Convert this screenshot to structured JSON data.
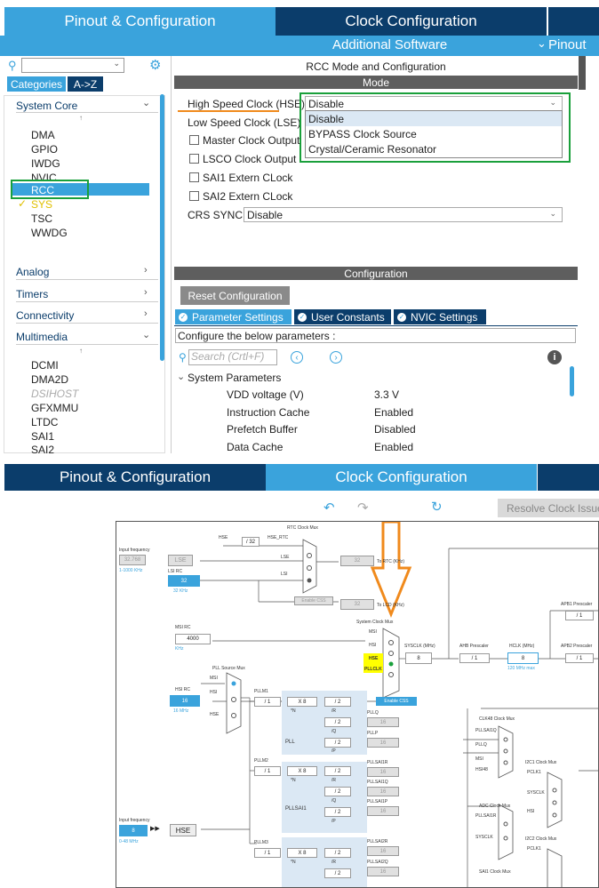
{
  "top": {
    "tabs": [
      {
        "label": "Pinout & Configuration"
      },
      {
        "label": "Clock Configuration"
      }
    ],
    "subbar": {
      "additional_software": "Additional Software",
      "pinout": "Pinout"
    },
    "sidebar": {
      "cat_tabs": [
        "Categories",
        "A->Z"
      ],
      "system_core": {
        "title": "System Core",
        "items": [
          "DMA",
          "GPIO",
          "IWDG",
          "NVIC",
          "RCC",
          "SYS",
          "TSC",
          "WWDG"
        ]
      },
      "groups": [
        "Analog",
        "Timers",
        "Connectivity",
        "Multimedia"
      ],
      "multimedia_items": [
        "DCMI",
        "DMA2D",
        "DSIHOST",
        "GFXMMU",
        "LTDC",
        "SAI1",
        "SAI2"
      ]
    },
    "rcc": {
      "title": "RCC Mode and Configuration",
      "mode_header": "Mode",
      "hse_label": "High Speed Clock (HSE)",
      "hse_value": "Disable",
      "lse_label": "Low Speed Clock (LSE)",
      "hse_options": [
        "Disable",
        "BYPASS Clock Source",
        "Crystal/Ceramic Resonator"
      ],
      "checkboxes": [
        "Master Clock Output",
        "LSCO Clock Output",
        "SAI1 Extern CLock",
        "SAI2 Extern CLock"
      ],
      "crs_label": "CRS SYNC",
      "crs_value": "Disable",
      "config_header": "Configuration",
      "reset_button": "Reset Configuration",
      "config_tabs": [
        "Parameter Settings",
        "User Constants",
        "NVIC Settings"
      ],
      "configure_text": "Configure the below parameters :",
      "search_placeholder": "Search (Crtl+F)",
      "section": "System Parameters",
      "params": [
        {
          "name": "VDD voltage (V)",
          "value": "3.3 V"
        },
        {
          "name": "Instruction Cache",
          "value": "Enabled"
        },
        {
          "name": "Prefetch Buffer",
          "value": "Disabled"
        },
        {
          "name": "Data Cache",
          "value": "Enabled"
        }
      ]
    }
  },
  "bottom": {
    "tabs": [
      {
        "label": "Pinout & Configuration"
      },
      {
        "label": "Clock Configuration"
      }
    ],
    "resolve_button": "Resolve Clock Issue",
    "diagram": {
      "input_frequency": "Input frequency",
      "lse_freq": "32.768",
      "lse_range": "1-1000 KHz",
      "lse": "LSE",
      "lsi_rc": "LSI RC",
      "lsi_val": "32",
      "lsi_unit": "32 KHz",
      "rtc_mux": "RTC Clock Mux",
      "hse_rtc": "HSE_RTC",
      "hse": "HSE",
      "div32": "/ 32",
      "lse_s": "LSE",
      "lsi_s": "LSI",
      "rtc_out": "32",
      "to_rtc": "To RTC (KHz)",
      "enable_css": "Enable CSS",
      "lcd_out": "32",
      "to_lcd": "To LCD (KHz)",
      "msi_rc": "MSI RC",
      "msi_val": "4000",
      "khz": "KHz",
      "sys_mux": "System Clock Mux",
      "msi": "MSI",
      "hsi": "HSI",
      "hse2": "HSE",
      "pllclk": "PLLCLK",
      "sysclk_label": "SYSCLK (MHz)",
      "sysclk_val": "8",
      "ahb_presc": "AHB Prescaler",
      "ahb_val": "/ 1",
      "hclk_label": "HCLK (MHz)",
      "hclk_val": "8",
      "hclk_max": "120 MHz max",
      "apb1": "APB1 Prescaler",
      "apb2": "APB2 Prescaler",
      "apb_val": "/ 1",
      "pll_src_mux": "PLL Source Mux",
      "hsi_rc": "HSI RC",
      "hsi_val": "16",
      "hsi_unit": "16 MHz",
      "pllm1": "PLLM1",
      "pllm_val": "/ 1",
      "xn": "X 8",
      "n": "*N",
      "div2": "/ 2",
      "r": "/R",
      "q": "/Q",
      "p": "/P",
      "pll": "PLL",
      "pllq": "PLLQ",
      "pllp": "PLLP",
      "out16": "16",
      "enable_css2": "Enable CSS",
      "clk48": "CLK48 Clock Mux",
      "pllsai1q": "PLLSAI1Q",
      "pllq2": "PLLQ",
      "msi2": "MSI",
      "hsi48": "HSI48",
      "i2c1_mux": "I2C1 Clock Mux",
      "pclk1": "PCLK1",
      "sysclk_s": "SYSCLK",
      "hsi_s": "HSI",
      "adc_mux": "ADC Clock Mux",
      "pllsai1r": "PLLSAI1R",
      "sysclk2": "SYSCLK",
      "i2c2_mux": "I2C2 Clock Mux",
      "pclk1b": "PCLK1",
      "sai1_mux": "SAI1 Clock Mux",
      "pllm2": "PLLM2",
      "pllsai1": "PLLSAI1",
      "pllsai1r2": "PLLSAI1R",
      "pllsai1q2": "PLLSAI1Q",
      "pllsai1p": "PLLSAI1P",
      "hse_freq": "8",
      "hse_range": "0-48 MHz",
      "hse_box": "HSE",
      "pllm3": "PLLM3",
      "pllsai2r": "PLLSAI2R",
      "pllsai2q": "PLLSAI2Q"
    }
  }
}
